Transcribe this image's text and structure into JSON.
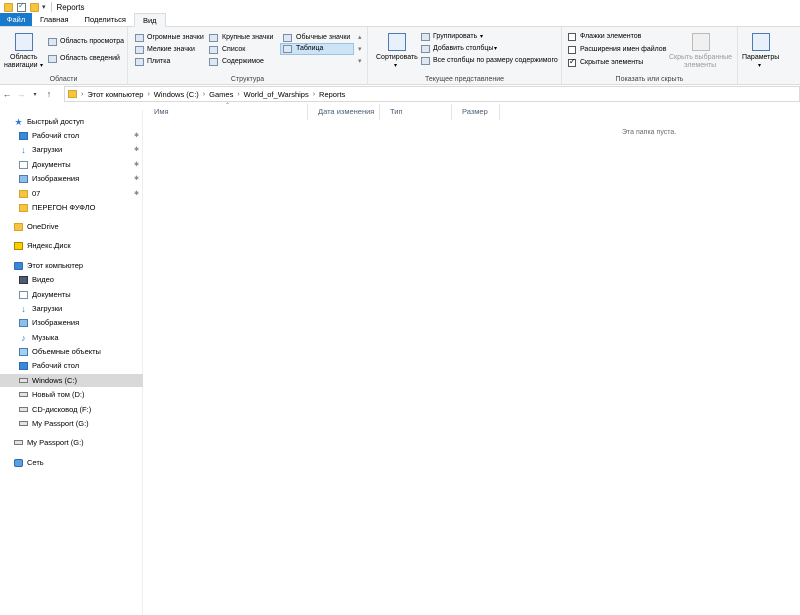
{
  "window": {
    "title": "Reports"
  },
  "tabs": [
    {
      "label": "Файл"
    },
    {
      "label": "Главная"
    },
    {
      "label": "Поделиться"
    },
    {
      "label": "Вид"
    }
  ],
  "ribbon": {
    "panes": {
      "group_label": "Области",
      "nav_pane_line1": "Область",
      "nav_pane_line2": "навигации",
      "preview_pane": "Область просмотра",
      "details_pane": "Область сведений"
    },
    "layout": {
      "group_label": "Структура",
      "extra_large": "Огромные значки",
      "large": "Крупные значки",
      "medium": "Обычные значки",
      "small": "Мелкие значки",
      "list": "Список",
      "details": "Таблица",
      "tiles": "Плитка",
      "content": "Содержимое"
    },
    "current_view": {
      "group_label": "Текущее представление",
      "sort_by": "Сортировать",
      "group_by": "Группировать",
      "add_columns": "Добавить столбцы",
      "size_columns": "Все столбцы по размеру содержимого"
    },
    "show_hide": {
      "group_label": "Показать или скрыть",
      "item_checkboxes": "Флажки элементов",
      "file_extensions": "Расширения имен файлов",
      "hidden_items": "Скрытые элементы",
      "hide_selected_line1": "Скрыть выбранные",
      "hide_selected_line2": "элементы"
    },
    "options": {
      "label": "Параметры"
    }
  },
  "address": {
    "crumbs": [
      "Этот компьютер",
      "Windows (C:)",
      "Games",
      "World_of_Warships",
      "Reports"
    ]
  },
  "nav": {
    "quick_access": "Быстрый доступ",
    "quick_items": [
      "Рабочий стол",
      "Загрузки",
      "Документы",
      "Изображения",
      "07",
      "ПЕРЕГОН ФУФЛО"
    ],
    "onedrive": "OneDrive",
    "yandex": "Яндекс.Диск",
    "this_pc": "Этот компьютер",
    "pc_items": [
      "Видео",
      "Документы",
      "Загрузки",
      "Изображения",
      "Музыка",
      "Объемные объекты",
      "Рабочий стол",
      "Windows (C:)",
      "Новый том (D:)",
      "CD-дисковод (F:)",
      "My Passport (G:)"
    ],
    "passport": "My Passport (G:)",
    "network": "Сеть"
  },
  "content": {
    "columns": [
      "Имя",
      "Дата изменения",
      "Тип",
      "Размер"
    ],
    "empty_message": "Эта папка пуста."
  }
}
